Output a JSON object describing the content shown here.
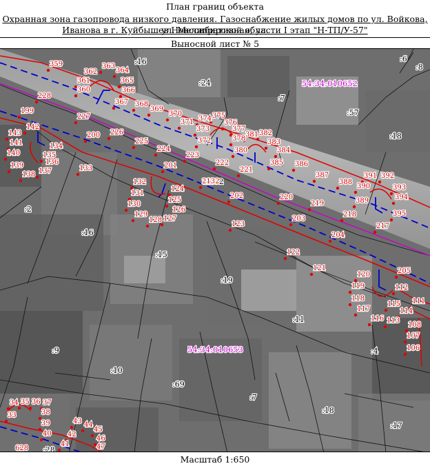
{
  "header": {
    "title": "План границ объекта",
    "subtitle_line1": "Охранная зона газопровода низкого давления. Газоснабжение жилых домов по ул. Войкова, ул. Мелиоративная, ул.",
    "subtitle_line2": "Иванова в г. Куйбышев Новосибирской области I этап \"Н-ТП/У-57\"",
    "sheet": "Выносной лист № 5"
  },
  "footer": {
    "scale": "Масштаб 1:650"
  },
  "colors": {
    "zone": "#e00000",
    "pipe": "#0000cc",
    "cadastre": "#cc00cc",
    "points": "#e00000"
  },
  "map": {
    "quarters": [
      "54:34:010652",
      "54:34:010653"
    ],
    "parcels": [
      ":16",
      ":24",
      ":7",
      ":57",
      ":18",
      ":6",
      ":8",
      ":2132",
      ":2",
      ":16",
      ":15",
      ":19",
      ":11",
      ":4",
      ":9",
      ":10",
      ":69",
      ":7",
      ":18",
      ":17",
      ":28"
    ],
    "points": [
      "359",
      "362",
      "363",
      "364",
      "361",
      "360",
      "365",
      "366",
      "228",
      "367",
      "368",
      "369",
      "370",
      "371",
      "374",
      "375",
      "376",
      "373",
      "377",
      "381",
      "382",
      "199",
      "227",
      "372",
      "378",
      "383",
      "142",
      "226",
      "380",
      "384",
      "143",
      "200",
      "225",
      "141",
      "134",
      "224",
      "223",
      "222",
      "221",
      "385",
      "386",
      "140",
      "135",
      "136",
      "201",
      "137",
      "138",
      "139",
      "133",
      "387",
      "388",
      "391",
      "392",
      "2132",
      "132",
      "124",
      "390",
      "393",
      "131",
      "202",
      "220",
      "219",
      "389",
      "394",
      "130",
      "125",
      "218",
      "129",
      "128",
      "127",
      "126",
      "395",
      "123",
      "203",
      "217",
      "204",
      "122",
      "121",
      "205",
      "120",
      "119",
      "112",
      "118",
      "111",
      "117",
      "114",
      "116",
      "113",
      "115",
      "108",
      "107",
      "106",
      "34",
      "35",
      "36",
      "37",
      "33",
      "38",
      "39",
      "40",
      "43",
      "44",
      "45",
      "46",
      "42",
      "41",
      "47",
      "628"
    ]
  }
}
